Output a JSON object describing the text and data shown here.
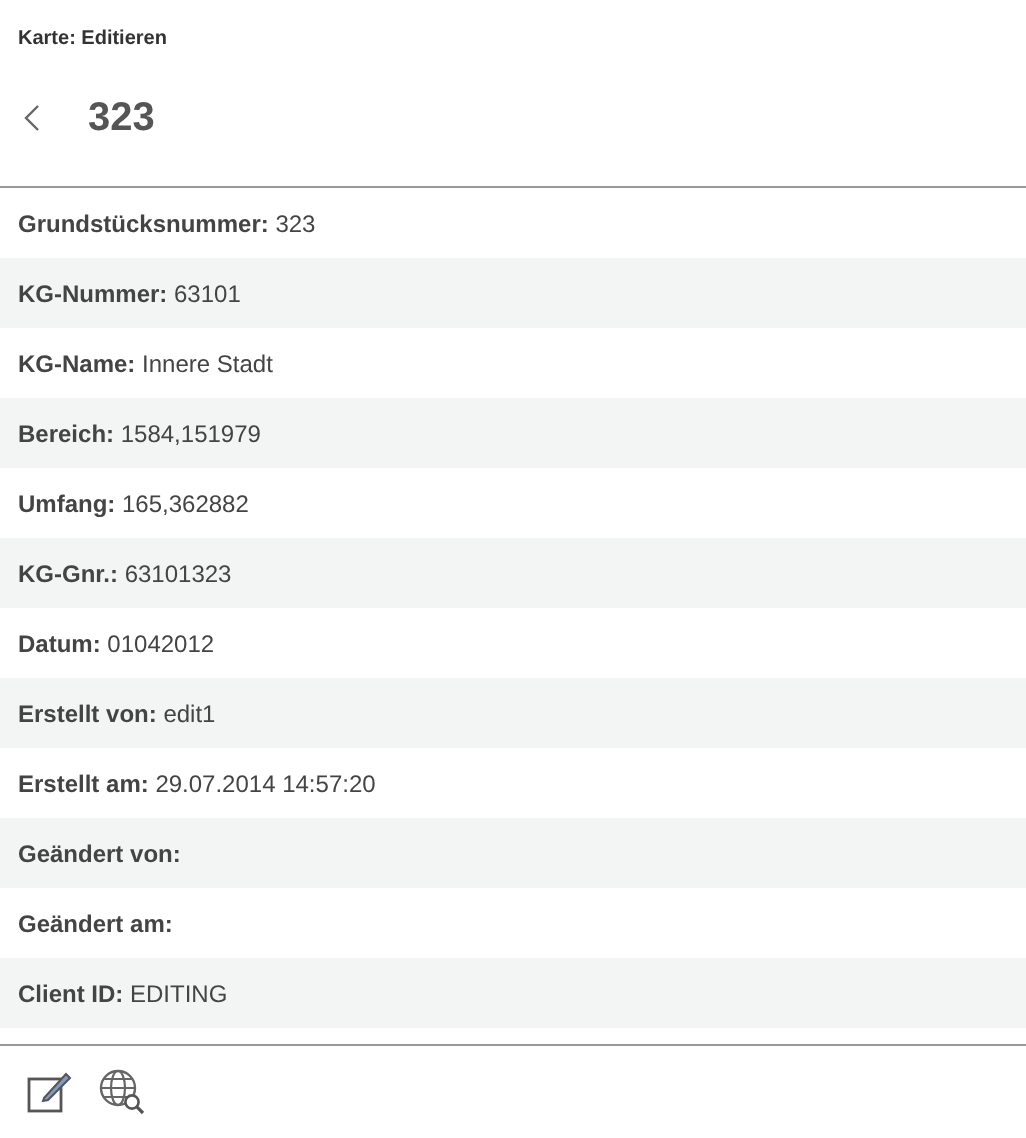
{
  "header": {
    "context": "Karte: Editieren",
    "title": "323"
  },
  "fields": [
    {
      "label": "Grundstücksnummer:",
      "value": "323"
    },
    {
      "label": "KG-Nummer:",
      "value": "63101"
    },
    {
      "label": "KG-Name:",
      "value": "Innere Stadt"
    },
    {
      "label": "Bereich:",
      "value": "1584,151979"
    },
    {
      "label": "Umfang:",
      "value": "165,362882"
    },
    {
      "label": "KG-Gnr.:",
      "value": "63101323"
    },
    {
      "label": "Datum:",
      "value": "01042012"
    },
    {
      "label": "Erstellt von:",
      "value": "edit1"
    },
    {
      "label": "Erstellt am:",
      "value": "29.07.2014 14:57:20"
    },
    {
      "label": "Geändert von:"
    },
    {
      "label": "Geändert am:"
    },
    {
      "label": "Client ID:",
      "value": "EDITING"
    }
  ]
}
